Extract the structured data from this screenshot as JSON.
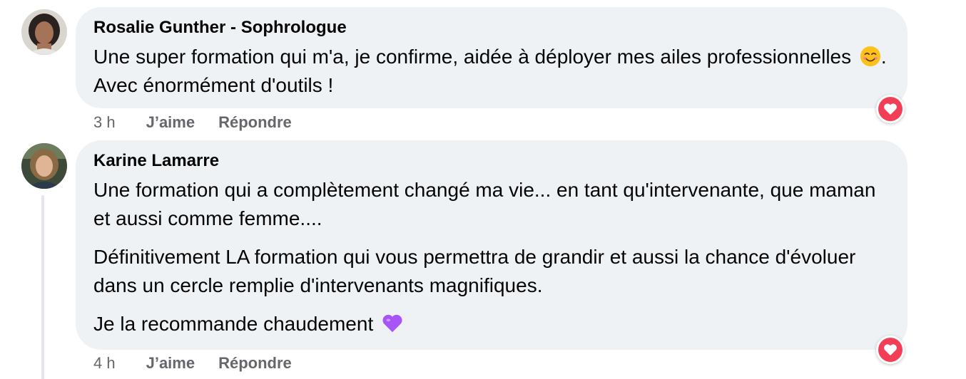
{
  "comments": [
    {
      "author": "Rosalie Gunther - Sophrologue",
      "paragraphs": [
        {
          "text": "Une super formation qui m'a, je confirme, aidée à déployer mes ailes professionnelles",
          "emoji": "smiling-face-emoji",
          "after": ". Avec énormément d'outils !"
        }
      ],
      "time": "3 h",
      "like_label": "J’aime",
      "reply_label": "Répondre",
      "reaction": "heart-reaction-icon"
    },
    {
      "author": "Karine Lamarre",
      "paragraphs": [
        {
          "text": "Une formation qui a complètement changé ma vie... en tant qu'intervenante, que maman et aussi comme femme...."
        },
        {
          "text": "Définitivement LA formation qui vous permettra de grandir et aussi la chance d'évoluer dans un cercle remplie d'intervenants magnifiques."
        },
        {
          "text": "Je la recommande chaudement",
          "emoji": "purple-heart-emoji"
        }
      ],
      "time": "4 h",
      "like_label": "J’aime",
      "reply_label": "Répondre",
      "reaction": "heart-reaction-icon"
    }
  ],
  "colors": {
    "bubble": "#eff2f5",
    "meta_text": "#65676b",
    "reaction": "#f33e58",
    "purple_heart": "#a855f7"
  }
}
